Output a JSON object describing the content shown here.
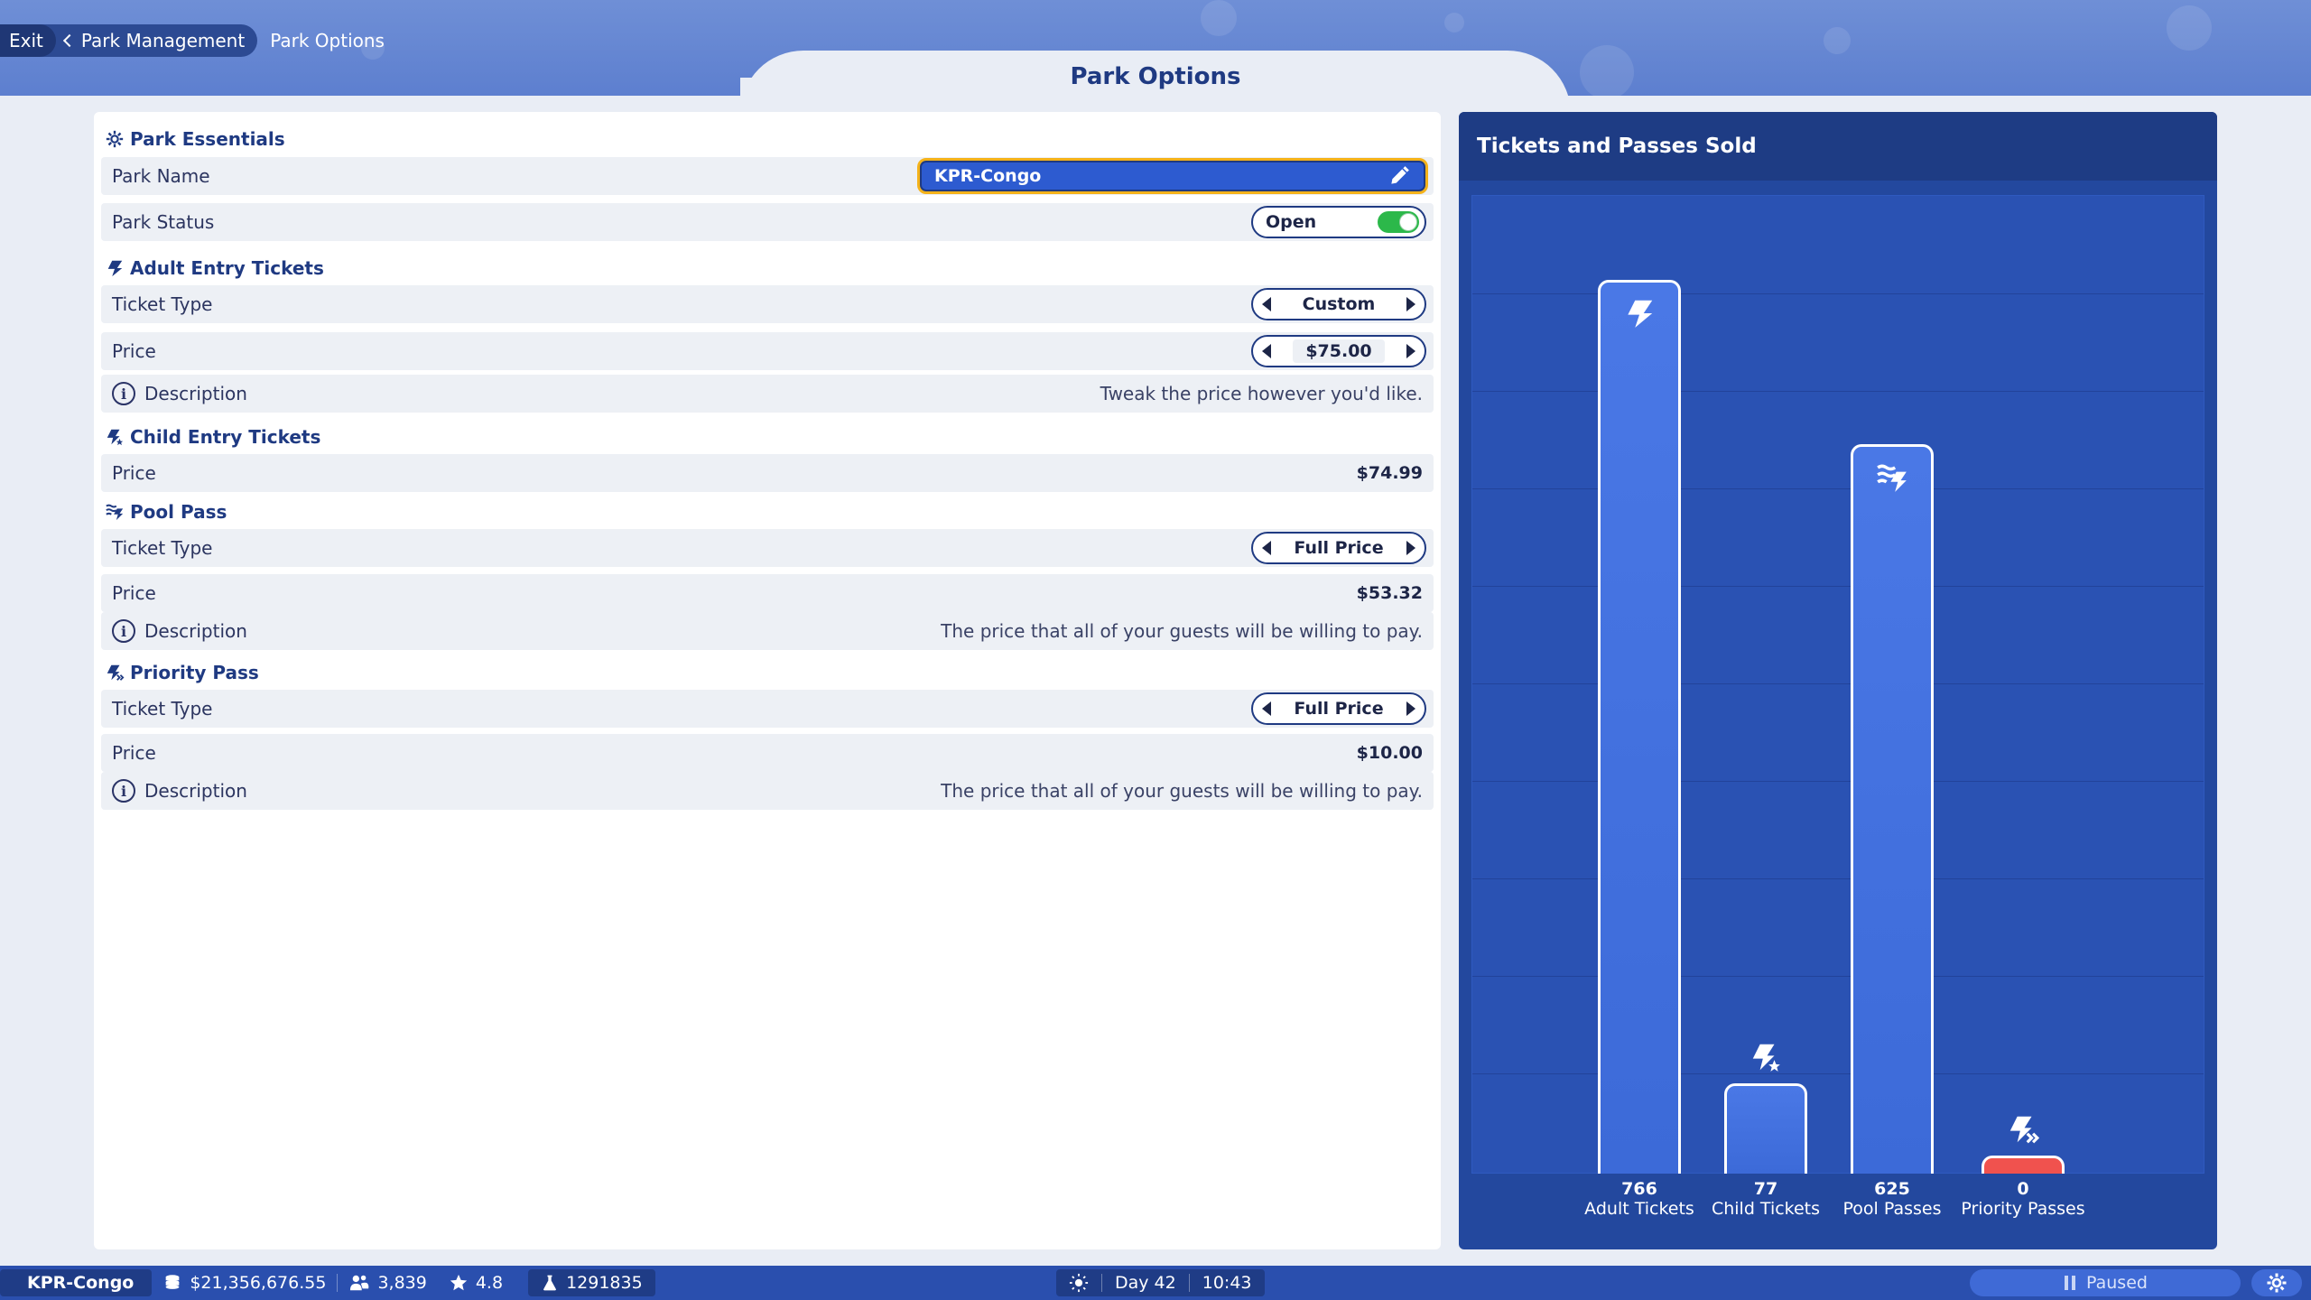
{
  "breadcrumb": {
    "exit": "Exit",
    "back": "Park Management",
    "current": "Park Options"
  },
  "page_title": "Park Options",
  "sections": {
    "essentials": {
      "title": "Park Essentials",
      "park_name_label": "Park Name",
      "park_name_value": "KPR-Congo",
      "park_status_label": "Park Status",
      "park_status_value": "Open"
    },
    "adult": {
      "title": "Adult Entry Tickets",
      "ticket_type_label": "Ticket Type",
      "ticket_type_value": "Custom",
      "price_label": "Price",
      "price_value": "$75.00",
      "description_label": "Description",
      "description_value": "Tweak the price however you'd like."
    },
    "child": {
      "title": "Child Entry Tickets",
      "price_label": "Price",
      "price_value": "$74.99"
    },
    "pool": {
      "title": "Pool Pass",
      "ticket_type_label": "Ticket Type",
      "ticket_type_value": "Full Price",
      "price_label": "Price",
      "price_value": "$53.32",
      "description_label": "Description",
      "description_value": "The price that all of your guests will be willing to pay."
    },
    "priority": {
      "title": "Priority Pass",
      "ticket_type_label": "Ticket Type",
      "ticket_type_value": "Full Price",
      "price_label": "Price",
      "price_value": "$10.00",
      "description_label": "Description",
      "description_value": "The price that all of your guests will be willing to pay."
    }
  },
  "chart_data": {
    "type": "bar",
    "title": "Tickets and Passes Sold",
    "categories": [
      "Adult Tickets",
      "Child Tickets",
      "Pool Passes",
      "Priority Passes"
    ],
    "values": [
      766,
      77,
      625,
      0
    ],
    "value_labels": [
      "766",
      "77",
      "625",
      "0"
    ],
    "ylim": [
      0,
      766
    ],
    "grid": true,
    "colors": [
      "#3f6fdd",
      "#3f6fdd",
      "#3f6fdd",
      "#f0524e"
    ],
    "icons": [
      "ticket-icon",
      "child-ticket-icon",
      "pool-pass-icon",
      "priority-pass-icon"
    ]
  },
  "statusbar": {
    "park_name": "KPR-Congo",
    "money": "$21,356,676.55",
    "guests": "3,839",
    "rating": "4.8",
    "research": "1291835",
    "day": "Day 42",
    "time": "10:43",
    "paused": "Paused"
  },
  "colors": {
    "accent": "#2d5bd0",
    "highlight": "#f4b21a",
    "toggle_on": "#2cb84a",
    "priority_bar": "#f0524e"
  }
}
